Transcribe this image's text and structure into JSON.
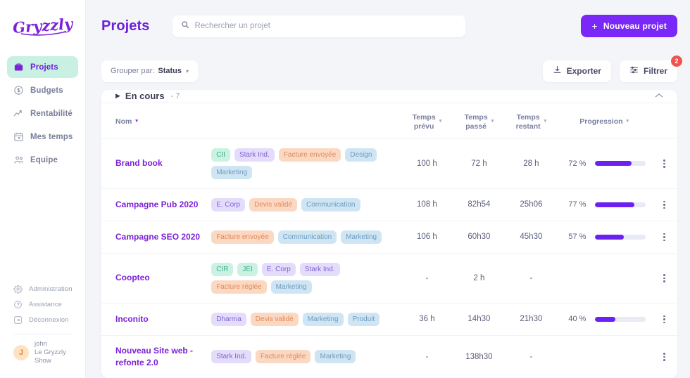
{
  "sidebar": {
    "logo_text": "Gryzzly",
    "items": [
      {
        "label": "Projets",
        "icon": "briefcase-icon",
        "active": true
      },
      {
        "label": "Budgets",
        "icon": "dollar-circle-icon",
        "active": false
      },
      {
        "label": "Rentabilité",
        "icon": "trending-up-icon",
        "active": false
      },
      {
        "label": "Mes temps",
        "icon": "calendar-icon",
        "active": false
      },
      {
        "label": "Equipe",
        "icon": "users-icon",
        "active": false
      }
    ],
    "bottom_items": [
      {
        "label": "Administration",
        "icon": "gear-icon"
      },
      {
        "label": "Assistance",
        "icon": "help-circle-icon"
      },
      {
        "label": "Déconnexion",
        "icon": "logout-icon"
      }
    ],
    "user": {
      "initial": "J",
      "name": "john",
      "org_line1": "Le Gryzzly",
      "org_line2": "Show"
    }
  },
  "header": {
    "title": "Projets",
    "search_placeholder": "Rechercher un projet",
    "search_value": "",
    "new_project_label": "Nouveau projet",
    "new_project_plus": "+"
  },
  "toolbar": {
    "group_by_label": "Grouper par:",
    "group_by_value": "Status",
    "export_label": "Exporter",
    "filter_label": "Filtrer",
    "filter_badge": "2"
  },
  "group": {
    "title": "En cours",
    "count": "- 7",
    "triangle": "▶",
    "collapse": "⌃"
  },
  "table": {
    "columns": [
      {
        "key": "name",
        "label": "Nom",
        "label2": "",
        "sort": "▾",
        "sort_active": true
      },
      {
        "key": "tags",
        "label": "",
        "label2": "",
        "sort": "",
        "sort_active": false
      },
      {
        "key": "planned",
        "label": "Temps",
        "label2": "prévu",
        "sort": "▾",
        "sort_active": false
      },
      {
        "key": "spent",
        "label": "Temps",
        "label2": "passé",
        "sort": "▾",
        "sort_active": false
      },
      {
        "key": "remaining",
        "label": "Temps",
        "label2": "restant",
        "sort": "▾",
        "sort_active": false
      },
      {
        "key": "progress",
        "label": "Progression",
        "label2": "",
        "sort": "▾",
        "sort_active": false
      }
    ],
    "rows": [
      {
        "name": "Brand book",
        "tags": [
          {
            "label": "CII",
            "color": "green"
          },
          {
            "label": "Stark Ind.",
            "color": "purple"
          },
          {
            "label": "Facture envoyée",
            "color": "orange"
          },
          {
            "label": "Design",
            "color": "blue"
          },
          {
            "label": "Marketing",
            "color": "blue"
          }
        ],
        "planned": "100 h",
        "spent": "72 h",
        "remaining": "28 h",
        "progress_label": "72 %",
        "progress": 72
      },
      {
        "name": "Campagne Pub 2020",
        "tags": [
          {
            "label": "E. Corp",
            "color": "purple"
          },
          {
            "label": "Devis validé",
            "color": "orange"
          },
          {
            "label": "Communication",
            "color": "blue"
          }
        ],
        "planned": "108 h",
        "spent": "82h54",
        "remaining": "25h06",
        "progress_label": "77 %",
        "progress": 77
      },
      {
        "name": "Campagne SEO 2020",
        "tags": [
          {
            "label": "Facture envoyée",
            "color": "orange"
          },
          {
            "label": "Communication",
            "color": "blue"
          },
          {
            "label": "Marketing",
            "color": "blue"
          }
        ],
        "planned": "106 h",
        "spent": "60h30",
        "remaining": "45h30",
        "progress_label": "57 %",
        "progress": 57
      },
      {
        "name": "Coopteo",
        "tags": [
          {
            "label": "CIR",
            "color": "green"
          },
          {
            "label": "JEI",
            "color": "green"
          },
          {
            "label": "E. Corp",
            "color": "purple"
          },
          {
            "label": "Stark Ind.",
            "color": "purple"
          },
          {
            "label": "Facture réglée",
            "color": "orange"
          },
          {
            "label": "Marketing",
            "color": "blue"
          }
        ],
        "planned": "-",
        "spent": "2 h",
        "remaining": "-",
        "progress_label": "",
        "progress": null
      },
      {
        "name": "Inconito",
        "tags": [
          {
            "label": "Dharma",
            "color": "purple"
          },
          {
            "label": "Devis validé",
            "color": "orange"
          },
          {
            "label": "Marketing",
            "color": "blue"
          },
          {
            "label": "Produit",
            "color": "blue"
          }
        ],
        "planned": "36 h",
        "spent": "14h30",
        "remaining": "21h30",
        "progress_label": "40 %",
        "progress": 40
      },
      {
        "name": "Nouveau Site web - refonte 2.0",
        "tags": [
          {
            "label": "Stark Ind.",
            "color": "purple"
          },
          {
            "label": "Facture réglée",
            "color": "orange"
          },
          {
            "label": "Marketing",
            "color": "blue"
          }
        ],
        "planned": "-",
        "spent": "138h30",
        "remaining": "-",
        "progress_label": "",
        "progress": null
      }
    ]
  },
  "colors": {
    "brand_purple": "#7928f7",
    "title_purple": "#6b21d6",
    "active_nav_bg": "#c8f0e3",
    "badge_red": "#ef5350",
    "progress_fill": "#6b21f0",
    "page_bg": "#f4f5f9"
  }
}
